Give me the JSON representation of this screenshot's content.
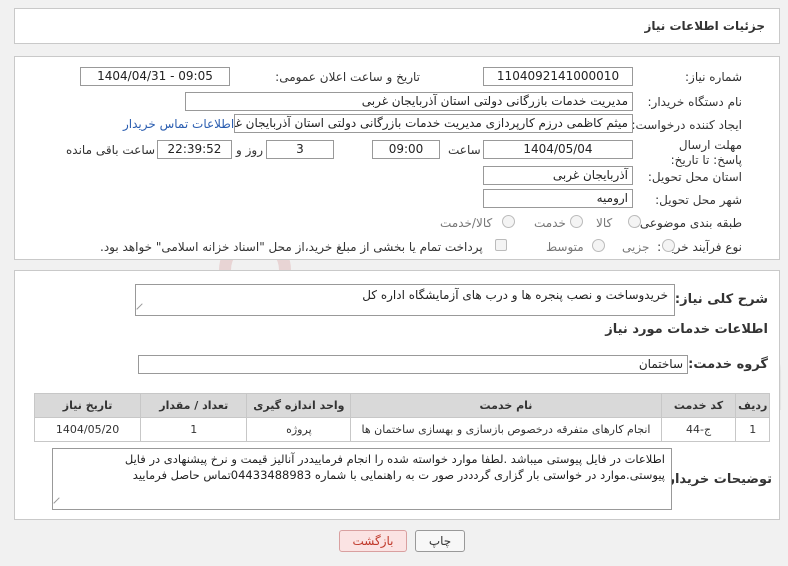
{
  "header": {
    "title": "جزئیات اطلاعات نیاز"
  },
  "form": {
    "need_number_label": "شماره نیاز:",
    "need_number": "1104092141000010",
    "announce_label": "تاریخ و ساعت اعلان عمومی:",
    "announce_value": "1404/04/31 - 09:05",
    "buyer_org_label": "نام دستگاه خریدار:",
    "buyer_org": "مدیریت خدمات بازرگانی دولتی استان آذربایجان غربی",
    "creator_label": "ایجاد کننده درخواست:",
    "creator": "میثم کاظمی درزم کارپردازی مدیریت خدمات بازرگانی دولتی استان آذربایجان غربی",
    "contact_link": "اطلاعات تماس خریدار",
    "deadline_label": "مهلت ارسال پاسخ: تا تاریخ:",
    "deadline_date": "1404/05/04",
    "time_label": "ساعت",
    "deadline_time": "09:00",
    "days_value": "3",
    "days_label": "روز و",
    "remaining_time": "22:39:52",
    "remaining_label": "ساعت باقی مانده",
    "province_label": "استان محل تحویل:",
    "province": "آذربایجان غربی",
    "city_label": "شهر محل تحویل:",
    "city": "ارومیه",
    "category_label": "طبقه بندی موضوعی:",
    "category_options": [
      "کالا",
      "خدمت",
      "کالا/خدمت"
    ],
    "process_label": "نوع فرآیند خرید :",
    "process_options": [
      "جزیی",
      "متوسط"
    ],
    "payment_note": "پرداخت تمام یا بخشی از مبلغ خرید،از محل \"اسناد خزانه اسلامی\" خواهد بود."
  },
  "details": {
    "description_label": "شرح کلی نیاز:",
    "description": "خریدوساخت و نصب پنجره ها و درب های آزمایشگاه اداره کل",
    "services_title": "اطلاعات خدمات مورد نیاز",
    "service_group_label": "گروه خدمت:",
    "service_group": "ساختمان",
    "table": {
      "headers": [
        "ردیف",
        "کد خدمت",
        "نام خدمت",
        "واحد اندازه گیری",
        "تعداد / مقدار",
        "تاریخ نیاز"
      ],
      "rows": [
        [
          "1",
          "ج-44",
          "انجام کارهای متفرقه درخصوص بازسازی و بهسازی ساختمان ها",
          "پروژه",
          "1",
          "1404/05/20"
        ]
      ]
    },
    "buyer_notes_label": "توضیحات خریدار:",
    "buyer_notes_line1": "اطلاعات در فایل پیوستی میباشد .لطفا موارد خواسته شده را انجام فرمایید‌در آنالیز قیمت و نرخ پیشنهادی در فایل",
    "buyer_notes_line2": "پیوستی.موارد در خواستی بار گزاری گردددر صور ت به راهنمایی با شماره 04433488983تماس حاصل فرمایید"
  },
  "buttons": {
    "print": "چاپ",
    "back": "بازگشت"
  },
  "watermark": "AriaTender.net",
  "colors": {
    "link": "#2a5db0",
    "back_button_text": "#c0392b",
    "back_button_bg": "#fbe3e3"
  }
}
